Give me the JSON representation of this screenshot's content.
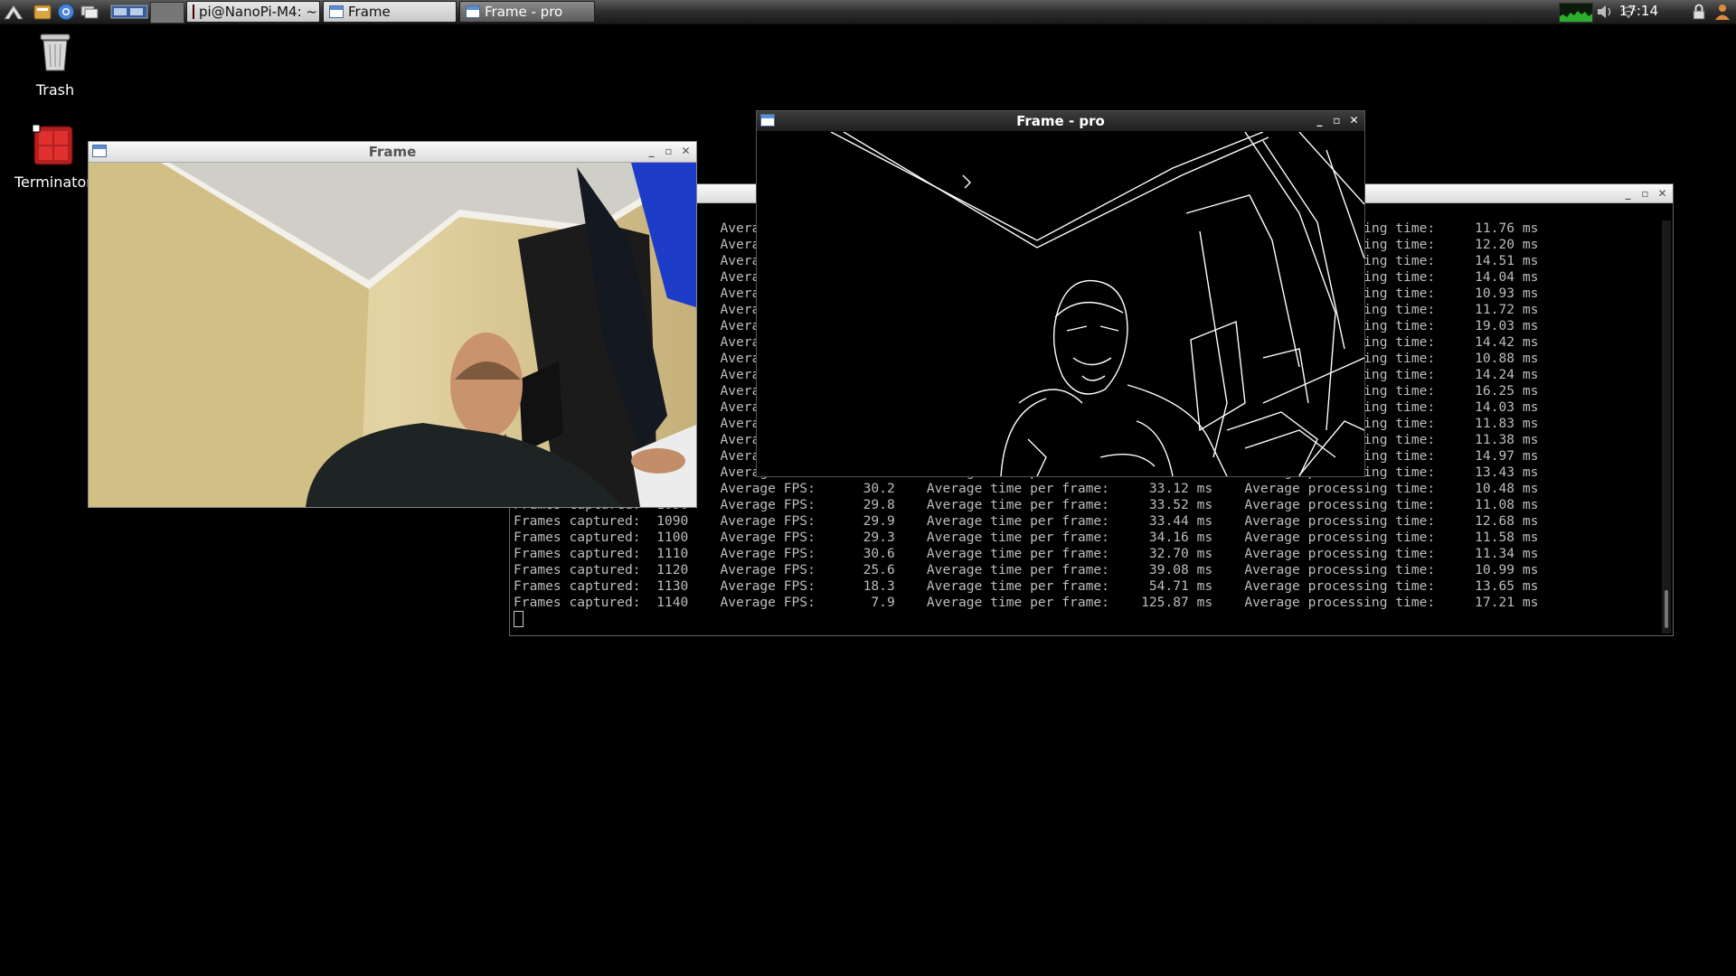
{
  "taskbar": {
    "launchers": [
      "menu-icon",
      "file-manager-icon",
      "browser-icon",
      "show-desktop-icon",
      "workspace-switcher-icon"
    ],
    "tasks": [
      {
        "label": "pi@NanoPi-M4: ~",
        "icon": "terminal-icon"
      },
      {
        "label": "Frame",
        "icon": "window-icon"
      },
      {
        "label": "Frame - pro",
        "icon": "window-icon"
      }
    ],
    "clock": "17:14",
    "tray": [
      "cpu-monitor-icon",
      "volume-icon",
      "network-icon",
      "lock-icon",
      "user-icon"
    ]
  },
  "desktop": {
    "icons": [
      {
        "label": "Trash",
        "icon": "trash-icon"
      },
      {
        "label": "Terminator",
        "icon": "terminator-icon"
      }
    ]
  },
  "frame_window": {
    "title": "Frame",
    "content": "camera-feed"
  },
  "frame_pro_window": {
    "title": "Frame - pro",
    "content": "edge-detection-feed"
  },
  "terminal": {
    "title": "",
    "lines": [
      "Frames captured:   920    Average FPS:      29.9    Average time per frame:     33.44 ms    Average processing time:     11.76 ms",
      "Frames captured:   930    Average FPS:      30.1    Average time per frame:     33.22 ms    Average processing time:     12.20 ms",
      "Frames captured:   940    Average FPS:      29.4    Average time per frame:     34.01 ms    Average processing time:     14.51 ms",
      "Frames captured:   950    Average FPS:      29.8    Average time per frame:     33.56 ms    Average processing time:     14.04 ms",
      "Frames captured:   960    Average FPS:      30.3    Average time per frame:     33.00 ms    Average processing time:     10.93 ms",
      "Frames captured:   970    Average FPS:      30.0    Average time per frame:     33.33 ms    Average processing time:     11.72 ms",
      "Frames captured:   980    Average FPS:      27.6    Average time per frame:     36.23 ms    Average processing time:     19.03 ms",
      "Frames captured:   990    Average FPS:      29.7    Average time per frame:     33.67 ms    Average processing time:     14.42 ms",
      "Frames captured:  1000    Average FPS:      30.2    Average time per frame:     33.11 ms    Average processing time:     10.88 ms",
      "Frames captured:  1010    Average FPS:      29.6    Average time per frame:     33.78 ms    Average processing time:     14.24 ms",
      "Frames captured:  1020    Average FPS:      28.9    Average time per frame:     34.60 ms    Average processing time:     16.25 ms",
      "Frames captured:  1030    Average FPS:      29.8    Average time per frame:     33.56 ms    Average processing time:     14.03 ms",
      "Frames captured:  1040    Average FPS:      30.1    Average time per frame:     33.22 ms    Average processing time:     11.83 ms",
      "Frames captured:  1050    Average FPS:      30.2    Average time per frame:     33.11 ms    Average processing time:     11.38 ms",
      "Frames captured:  1060    Average FPS:      29.5    Average time per frame:     33.90 ms    Average processing time:     14.97 ms",
      "Frames captured:  1070    Average FPS:      29.9    Average time per frame:     33.44 ms    Average processing time:     13.43 ms",
      "Frames captured:  1080    Average FPS:      30.2    Average time per frame:     33.12 ms    Average processing time:     10.48 ms",
      "Frames captured:  1090    Average FPS:      29.8    Average time per frame:     33.52 ms    Average processing time:     11.08 ms",
      "Frames captured:  1090    Average FPS:      29.9    Average time per frame:     33.44 ms    Average processing time:     12.68 ms",
      "Frames captured:  1100    Average FPS:      29.3    Average time per frame:     34.16 ms    Average processing time:     11.58 ms",
      "Frames captured:  1110    Average FPS:      30.6    Average time per frame:     32.70 ms    Average processing time:     11.34 ms",
      "Frames captured:  1120    Average FPS:      25.6    Average time per frame:     39.08 ms    Average processing time:     10.99 ms",
      "Frames captured:  1130    Average FPS:      18.3    Average time per frame:     54.71 ms    Average processing time:     13.65 ms",
      "Frames captured:  1140    Average FPS:       7.9    Average time per frame:    125.87 ms    Average processing time:     17.21 ms"
    ]
  }
}
